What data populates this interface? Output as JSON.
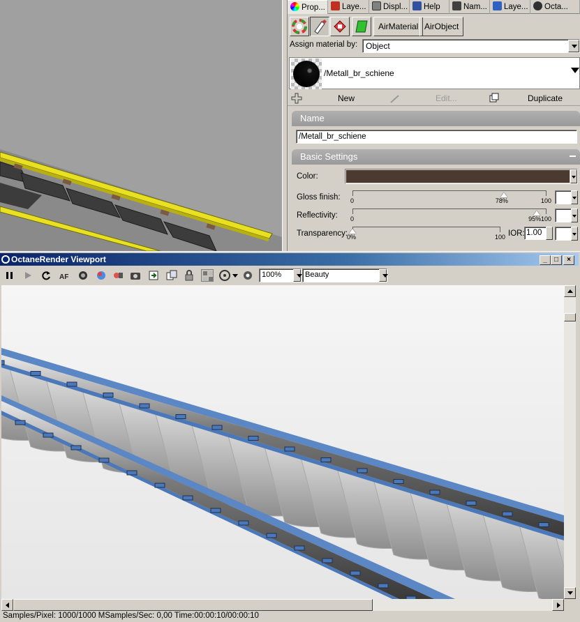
{
  "properties_panel": {
    "tabs": [
      {
        "label": "Prop...",
        "icon": "color-wheel-icon",
        "color": "#d04040"
      },
      {
        "label": "Laye...",
        "icon": "layers-icon",
        "color": "#c03020"
      },
      {
        "label": "Displ...",
        "icon": "monitor-icon",
        "color": "#606060"
      },
      {
        "label": "Help",
        "icon": "help-icon",
        "color": "#3050a0"
      },
      {
        "label": "Nam...",
        "icon": "camera-icon",
        "color": "#303030"
      },
      {
        "label": "Laye...",
        "icon": "layers-icon",
        "color": "#3060c0"
      },
      {
        "label": "Octa...",
        "icon": "octane-icon",
        "color": "#303030"
      }
    ],
    "toolbar": {
      "air_material_label": "AirMaterial",
      "air_object_label": "AirObject"
    },
    "assign_material_label": "Assign material by:",
    "assign_material_value": "Object",
    "material_name": "/Metall_br_schiene",
    "actions": {
      "new_label": "New",
      "edit_label": "Edit...",
      "duplicate_label": "Duplicate"
    },
    "name_section": {
      "title": "Name",
      "value": "/Metall_br_schiene"
    },
    "basic_settings": {
      "title": "Basic Settings",
      "color_label": "Color:",
      "color_value": "#4a3a30",
      "gloss": {
        "label": "Gloss finish:",
        "min": "0",
        "max": "100",
        "value_text": "78%",
        "value": 78
      },
      "reflectivity": {
        "label": "Reflectivity:",
        "min": "0",
        "max": "100",
        "value_text": "95%",
        "value": 95
      },
      "transparency": {
        "label": "Transparency:",
        "min": "0%",
        "max": "100",
        "value": 0
      },
      "ior_label": "IOR:",
      "ior_value": "1.00"
    }
  },
  "octane": {
    "title": "OctaneRender Viewport",
    "zoom": "100%",
    "mode": "Beauty",
    "status": "Samples/Pixel: 1000/1000  MSamples/Sec: 0,00  Time:00:00:10/00:00:10"
  }
}
